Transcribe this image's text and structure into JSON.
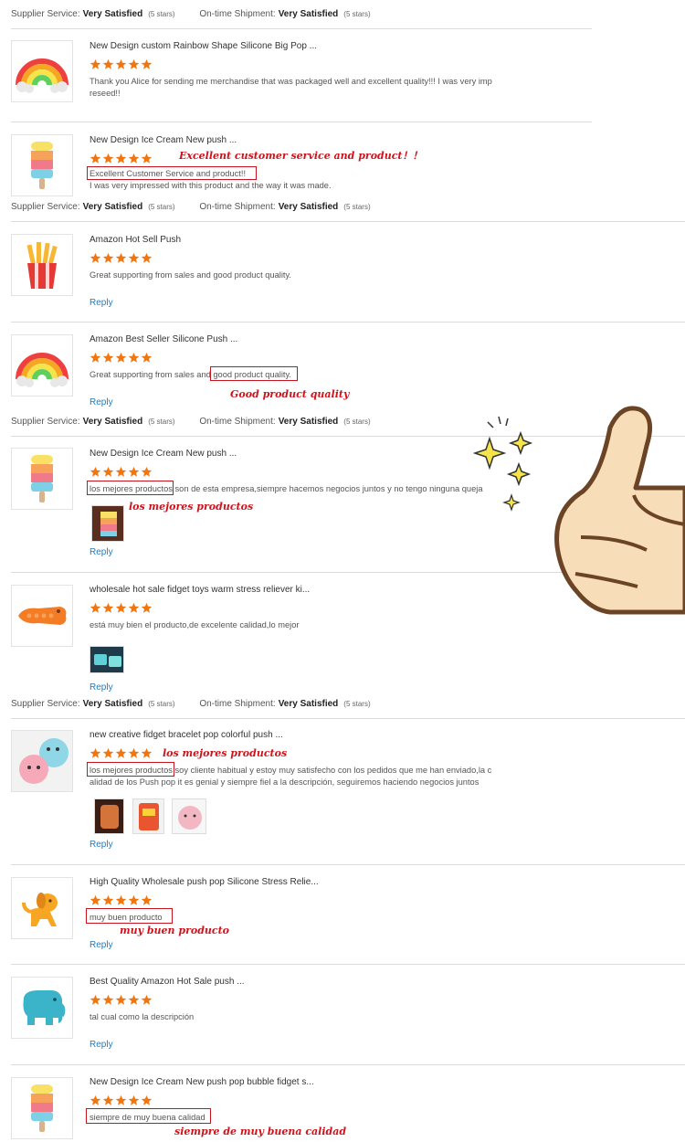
{
  "satisfaction": {
    "supplier_label": "Supplier Service:",
    "shipment_label": "On-time Shipment:",
    "value": "Very Satisfied",
    "stars_text": "(5 stars)"
  },
  "reply_label": "Reply",
  "rating_stars": 5,
  "colors": {
    "accent_star": "#f07612",
    "annotation": "#d0121b",
    "link": "#1a7ec7"
  },
  "reviews": [
    {
      "title": "New Design custom Rainbow Shape Silicone Big Pop ...",
      "icon": "rainbow-product-icon",
      "comment": [
        "Thank you Alice for sending me merchandise that was packaged well and excellent quality!!! I was very imp",
        "reseed!!"
      ]
    },
    {
      "title": "New Design Ice Cream New push ...",
      "icon": "ice-cream-product-icon",
      "comment": [
        "Excellent Customer Service and product!!",
        "I was very impressed with this product and the way it was made."
      ],
      "annotation": "Excellent customer service and product！！"
    },
    {
      "title": "Amazon Hot Sell Push",
      "icon": "fries-product-icon",
      "comment": [
        "Great supporting from sales and good product quality."
      ]
    },
    {
      "title": "Amazon Best Seller Silicone Push ...",
      "icon": "rainbow-product-icon",
      "comment_prefix": "Great supporting from sales and ",
      "comment_highlight": "good product quality.",
      "annotation": "Good product quality"
    },
    {
      "title": "New Design Ice Cream New push ...",
      "icon": "ice-cream-product-icon",
      "comment_highlight": "los mejores productos",
      "comment_suffix": " son de esta empresa,siempre hacemos negocios juntos y no tengo ninguna queja",
      "annotation": "los mejores productos"
    },
    {
      "title": "wholesale hot sale fidget toys warm stress reliever ki...",
      "icon": "crocodile-product-icon",
      "comment": [
        "está muy bien el producto,de excelente calidad,lo mejor"
      ]
    },
    {
      "title": "new creative fidget bracelet pop colorful push ...",
      "icon": "bracelet-product-icon",
      "comment_highlight": "los mejores productos",
      "comment_suffix": " soy cliente habitual y estoy muy satisfecho con los pedidos que me han enviado,la c",
      "comment_line2": "alidad de los Push pop it es genial y siempre fiel a la descripción, seguiremos haciendo negocios juntos",
      "annotation": "los mejores productos"
    },
    {
      "title": "High Quality Wholesale push pop Silicone Stress Relie...",
      "icon": "dog-product-icon",
      "comment_highlight": "muy buen producto",
      "annotation": "muy buen producto"
    },
    {
      "title": "Best Quality Amazon Hot Sale push ...",
      "icon": "elephant-product-icon",
      "comment": [
        "tal cual como la descripción"
      ]
    },
    {
      "title": "New Design Ice Cream New push pop bubble fidget s...",
      "icon": "ice-cream-product-icon",
      "comment_highlight": "siempre de muy buena calidad",
      "annotation": "siempre de muy buena calidad"
    }
  ]
}
